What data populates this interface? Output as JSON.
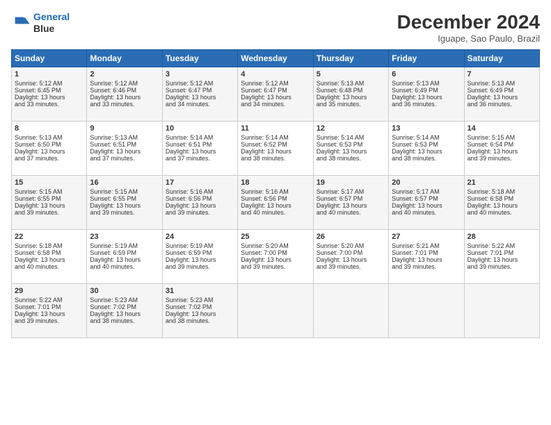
{
  "header": {
    "logo_line1": "General",
    "logo_line2": "Blue",
    "title": "December 2024",
    "subtitle": "Iguape, Sao Paulo, Brazil"
  },
  "weekdays": [
    "Sunday",
    "Monday",
    "Tuesday",
    "Wednesday",
    "Thursday",
    "Friday",
    "Saturday"
  ],
  "weeks": [
    [
      {
        "day": "1",
        "lines": [
          "Sunrise: 5:12 AM",
          "Sunset: 6:45 PM",
          "Daylight: 13 hours",
          "and 33 minutes."
        ]
      },
      {
        "day": "2",
        "lines": [
          "Sunrise: 5:12 AM",
          "Sunset: 6:46 PM",
          "Daylight: 13 hours",
          "and 33 minutes."
        ]
      },
      {
        "day": "3",
        "lines": [
          "Sunrise: 5:12 AM",
          "Sunset: 6:47 PM",
          "Daylight: 13 hours",
          "and 34 minutes."
        ]
      },
      {
        "day": "4",
        "lines": [
          "Sunrise: 5:12 AM",
          "Sunset: 6:47 PM",
          "Daylight: 13 hours",
          "and 34 minutes."
        ]
      },
      {
        "day": "5",
        "lines": [
          "Sunrise: 5:13 AM",
          "Sunset: 6:48 PM",
          "Daylight: 13 hours",
          "and 35 minutes."
        ]
      },
      {
        "day": "6",
        "lines": [
          "Sunrise: 5:13 AM",
          "Sunset: 6:49 PM",
          "Daylight: 13 hours",
          "and 36 minutes."
        ]
      },
      {
        "day": "7",
        "lines": [
          "Sunrise: 5:13 AM",
          "Sunset: 6:49 PM",
          "Daylight: 13 hours",
          "and 36 minutes."
        ]
      }
    ],
    [
      {
        "day": "8",
        "lines": [
          "Sunrise: 5:13 AM",
          "Sunset: 6:50 PM",
          "Daylight: 13 hours",
          "and 37 minutes."
        ]
      },
      {
        "day": "9",
        "lines": [
          "Sunrise: 5:13 AM",
          "Sunset: 6:51 PM",
          "Daylight: 13 hours",
          "and 37 minutes."
        ]
      },
      {
        "day": "10",
        "lines": [
          "Sunrise: 5:14 AM",
          "Sunset: 6:51 PM",
          "Daylight: 13 hours",
          "and 37 minutes."
        ]
      },
      {
        "day": "11",
        "lines": [
          "Sunrise: 5:14 AM",
          "Sunset: 6:52 PM",
          "Daylight: 13 hours",
          "and 38 minutes."
        ]
      },
      {
        "day": "12",
        "lines": [
          "Sunrise: 5:14 AM",
          "Sunset: 6:53 PM",
          "Daylight: 13 hours",
          "and 38 minutes."
        ]
      },
      {
        "day": "13",
        "lines": [
          "Sunrise: 5:14 AM",
          "Sunset: 6:53 PM",
          "Daylight: 13 hours",
          "and 38 minutes."
        ]
      },
      {
        "day": "14",
        "lines": [
          "Sunrise: 5:15 AM",
          "Sunset: 6:54 PM",
          "Daylight: 13 hours",
          "and 39 minutes."
        ]
      }
    ],
    [
      {
        "day": "15",
        "lines": [
          "Sunrise: 5:15 AM",
          "Sunset: 6:55 PM",
          "Daylight: 13 hours",
          "and 39 minutes."
        ]
      },
      {
        "day": "16",
        "lines": [
          "Sunrise: 5:15 AM",
          "Sunset: 6:55 PM",
          "Daylight: 13 hours",
          "and 39 minutes."
        ]
      },
      {
        "day": "17",
        "lines": [
          "Sunrise: 5:16 AM",
          "Sunset: 6:56 PM",
          "Daylight: 13 hours",
          "and 39 minutes."
        ]
      },
      {
        "day": "18",
        "lines": [
          "Sunrise: 5:16 AM",
          "Sunset: 6:56 PM",
          "Daylight: 13 hours",
          "and 40 minutes."
        ]
      },
      {
        "day": "19",
        "lines": [
          "Sunrise: 5:17 AM",
          "Sunset: 6:57 PM",
          "Daylight: 13 hours",
          "and 40 minutes."
        ]
      },
      {
        "day": "20",
        "lines": [
          "Sunrise: 5:17 AM",
          "Sunset: 6:57 PM",
          "Daylight: 13 hours",
          "and 40 minutes."
        ]
      },
      {
        "day": "21",
        "lines": [
          "Sunrise: 5:18 AM",
          "Sunset: 6:58 PM",
          "Daylight: 13 hours",
          "and 40 minutes."
        ]
      }
    ],
    [
      {
        "day": "22",
        "lines": [
          "Sunrise: 5:18 AM",
          "Sunset: 6:58 PM",
          "Daylight: 13 hours",
          "and 40 minutes."
        ]
      },
      {
        "day": "23",
        "lines": [
          "Sunrise: 5:19 AM",
          "Sunset: 6:59 PM",
          "Daylight: 13 hours",
          "and 40 minutes."
        ]
      },
      {
        "day": "24",
        "lines": [
          "Sunrise: 5:19 AM",
          "Sunset: 6:59 PM",
          "Daylight: 13 hours",
          "and 39 minutes."
        ]
      },
      {
        "day": "25",
        "lines": [
          "Sunrise: 5:20 AM",
          "Sunset: 7:00 PM",
          "Daylight: 13 hours",
          "and 39 minutes."
        ]
      },
      {
        "day": "26",
        "lines": [
          "Sunrise: 5:20 AM",
          "Sunset: 7:00 PM",
          "Daylight: 13 hours",
          "and 39 minutes."
        ]
      },
      {
        "day": "27",
        "lines": [
          "Sunrise: 5:21 AM",
          "Sunset: 7:01 PM",
          "Daylight: 13 hours",
          "and 39 minutes."
        ]
      },
      {
        "day": "28",
        "lines": [
          "Sunrise: 5:22 AM",
          "Sunset: 7:01 PM",
          "Daylight: 13 hours",
          "and 39 minutes."
        ]
      }
    ],
    [
      {
        "day": "29",
        "lines": [
          "Sunrise: 5:22 AM",
          "Sunset: 7:01 PM",
          "Daylight: 13 hours",
          "and 39 minutes."
        ]
      },
      {
        "day": "30",
        "lines": [
          "Sunrise: 5:23 AM",
          "Sunset: 7:02 PM",
          "Daylight: 13 hours",
          "and 38 minutes."
        ]
      },
      {
        "day": "31",
        "lines": [
          "Sunrise: 5:23 AM",
          "Sunset: 7:02 PM",
          "Daylight: 13 hours",
          "and 38 minutes."
        ]
      },
      null,
      null,
      null,
      null
    ]
  ]
}
